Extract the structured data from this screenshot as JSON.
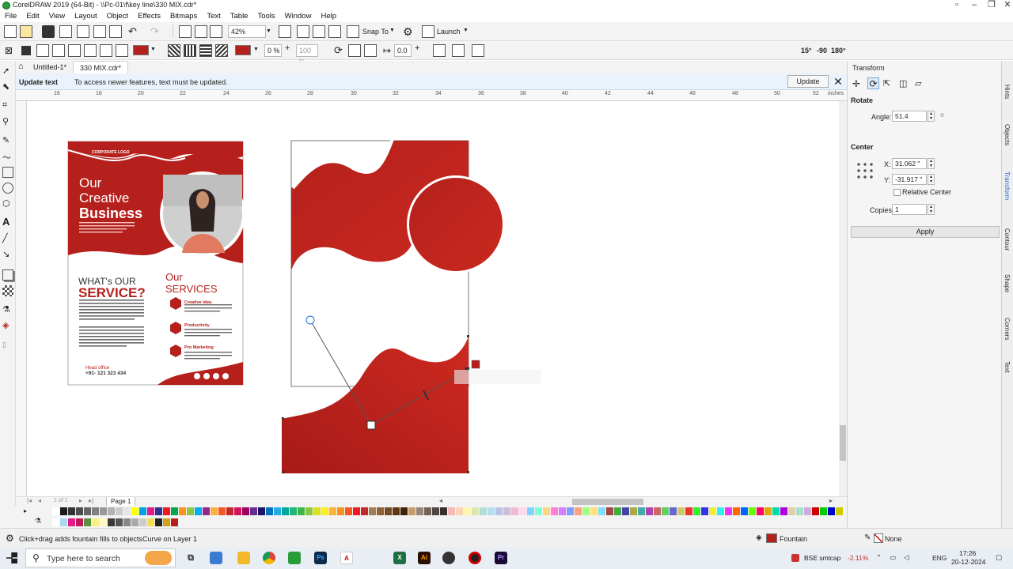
{
  "window": {
    "title": "CorelDRAW 2019 (64-Bit) - \\\\Pc-01\\f\\key line\\330 MIX.cdr*"
  },
  "menu": [
    "File",
    "Edit",
    "View",
    "Layout",
    "Object",
    "Effects",
    "Bitmaps",
    "Text",
    "Table",
    "Tools",
    "Window",
    "Help"
  ],
  "toolbar": {
    "zoom": "42%",
    "snap_to": "Snap To",
    "launch": "Launch",
    "opacity": "0 %",
    "percent100": "100 %",
    "offset": "0.0",
    "angle_presets": [
      "15°",
      "-90",
      "180°"
    ]
  },
  "doc_tabs": [
    "Untitled-1*",
    "330 MIX.cdr*"
  ],
  "banner": {
    "title": "Update text",
    "message": "To access newer features, text must be updated.",
    "button": "Update"
  },
  "ruler": {
    "labels": [
      "16",
      "18",
      "20",
      "22",
      "24",
      "26",
      "28",
      "30",
      "32",
      "34",
      "36",
      "38",
      "40",
      "42",
      "44",
      "46",
      "48",
      "50",
      "52",
      "inches"
    ]
  },
  "flyer": {
    "logo": "CORPORATE LOGO",
    "headline1": "Our",
    "headline2": "Creative",
    "headline3": "Business",
    "whats": "WHAT's OUR",
    "service": "SERVICE?",
    "our": "Our",
    "services": "SERVICES",
    "items": [
      "Creative Idea",
      "Productivity",
      "Pro Marketing"
    ],
    "head_office": "Head office",
    "phone": "+91- 121 323 434"
  },
  "page_nav": {
    "count": "1 of 1",
    "page": "Page 1"
  },
  "docker": {
    "title": "Transform",
    "rotate": "Rotate",
    "angle_label": "Angle:",
    "angle_value": "51.4",
    "center": "Center",
    "x_label": "X:",
    "x_value": "31.062 \"",
    "y_label": "Y:",
    "y_value": "-31.917 \"",
    "relative_center": "Relative Center",
    "copies_label": "Copies:",
    "copies_value": "1",
    "apply": "Apply"
  },
  "side_tabs": [
    "Hints",
    "Objects",
    "Transform",
    "Contour",
    "Shape",
    "Corners",
    "Text"
  ],
  "status": {
    "hint": "Click+drag adds fountain fills to objects",
    "object": "Curve on Layer 1",
    "fill": "Fountain",
    "outline": "None"
  },
  "taskbar": {
    "search": "Type here to search",
    "stock": "BSE smlcap",
    "stock_change": "-2.11%",
    "lang": "ENG",
    "time": "17:26",
    "date": "20-12-2024"
  },
  "colors": {
    "brand_red": "#b5201c",
    "accent_blue": "#1f6fd1"
  }
}
